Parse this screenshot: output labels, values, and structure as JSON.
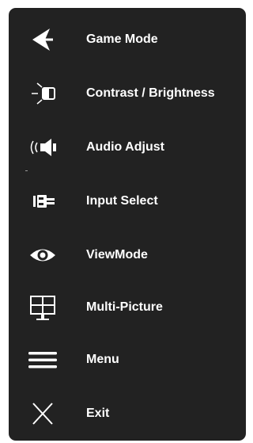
{
  "menu": {
    "items": [
      {
        "label": "Game Mode",
        "icon": "game-mode-icon"
      },
      {
        "label": "Contrast / Brightness",
        "icon": "contrast-brightness-icon"
      },
      {
        "label": "Audio Adjust",
        "icon": "audio-icon"
      },
      {
        "label": "Input Select",
        "icon": "input-select-icon"
      },
      {
        "label": "ViewMode",
        "icon": "eye-icon"
      },
      {
        "label": "Multi-Picture",
        "icon": "multi-picture-icon"
      },
      {
        "label": "Menu",
        "icon": "menu-icon"
      },
      {
        "label": "Exit",
        "icon": "close-icon"
      }
    ]
  },
  "colors": {
    "panel_background": "#222222",
    "text": "#ffffff"
  }
}
